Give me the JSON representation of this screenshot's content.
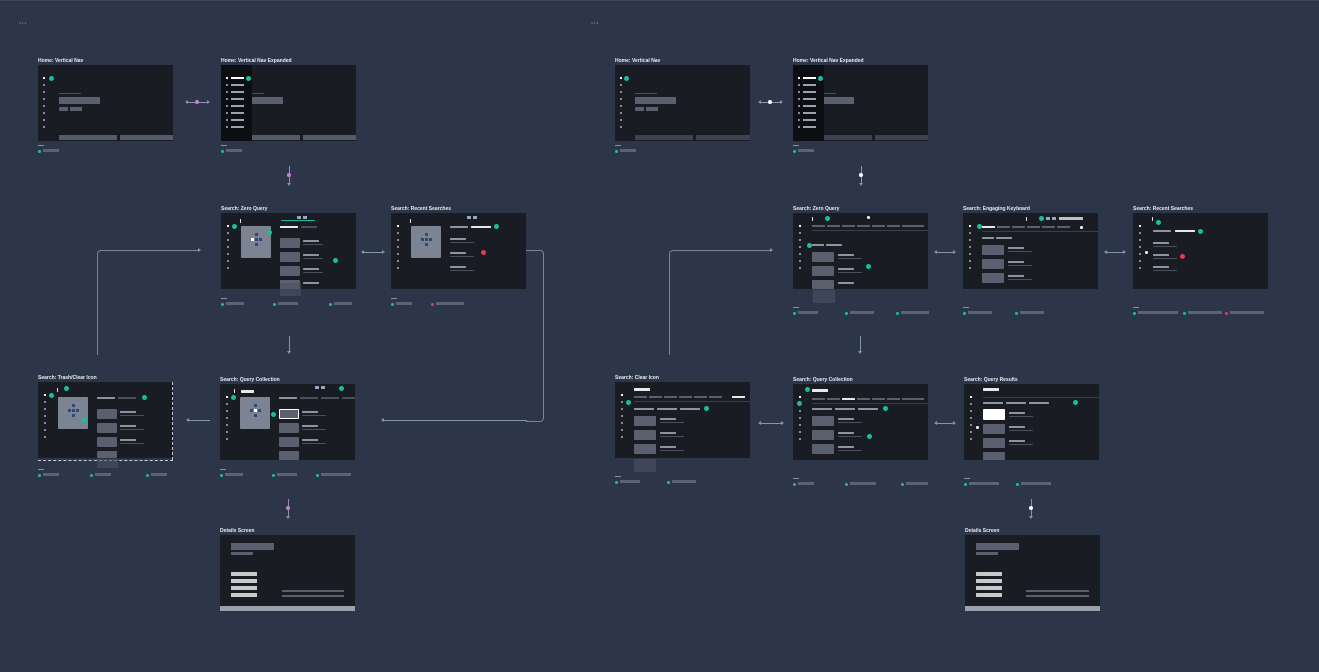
{
  "sections": [
    {
      "label": "3.1.1"
    },
    {
      "label": "3.1.2"
    }
  ],
  "left": {
    "titles": {
      "home_vertical_nav": "Home: Vertical Nav",
      "home_vertical_nav_expanded": "Home: Vertical Nav Expanded",
      "search_zero_query": "Search: Zero Query",
      "search_recent_searches": "Search: Recent Searches",
      "search_trash_clear_icon": "Search: Trash/Clear Icon",
      "search_query_collection": "Search: Query Collection",
      "details_screen": "Details Screen"
    }
  },
  "right": {
    "titles": {
      "home_vertical_nav": "Home: Vertical Nav",
      "home_vertical_nav_expanded": "Home: Vertical Nav Expanded",
      "search_zero_query": "Search: Zero Query",
      "search_engaging_keyboard": "Search: Engaging Keyboard",
      "search_recent_searches": "Search: Recent Searches",
      "search_clear_icon": "Search: Clear Icon",
      "search_query_collection": "Search: Query Collection",
      "search_query_results": "Search: Query Results",
      "details_screen": "Details Screen"
    }
  },
  "colors": {
    "background": "#2d3548",
    "frame": "#1a1c23",
    "accent_marker": "#17c098",
    "alert_marker": "#e03a5a",
    "transition_dot": "#c77de0"
  },
  "icons": {
    "annotation_marker": "teal-dot-icon",
    "alert_marker": "red-dot-icon",
    "transition": "pink-dot-icon"
  }
}
